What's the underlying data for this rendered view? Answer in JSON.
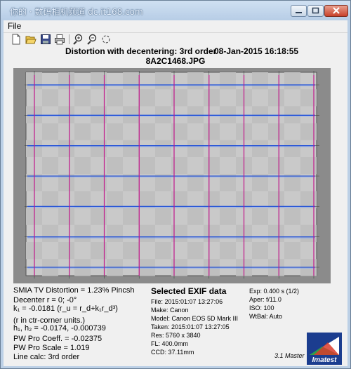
{
  "window": {
    "title": "你的 · 数码相机频道 dc.it168.com"
  },
  "menu": {
    "file": "File"
  },
  "toolbar": {
    "buttons": [
      "new-icon",
      "open-folder-icon",
      "save-icon",
      "print-icon",
      "zoom-in-icon",
      "zoom-out-icon",
      "refresh-icon"
    ]
  },
  "chart_header": {
    "title": "Distortion with decentering:  3rd order",
    "date": "08-Jan-2015 16:18:55",
    "filename": "8A2C1468.JPG"
  },
  "chart_data": {
    "type": "grid-overlay",
    "vertical_line_color": "#c2188b",
    "horizontal_line_color": "#1f4fd8",
    "vertical_lines": 9,
    "horizontal_lines": 7
  },
  "left_panel": {
    "smia": "SMIA TV Distortion = 1.23% Pincsh",
    "decenter": "Decenter r = 0;  -0°",
    "k1": "k₁ = -0.0181  (r_u = r_d+k₁r_d³)",
    "units": "(r in ctr-corner units.)",
    "h": "h₁, h₂ = -0.0174, -0.000739",
    "coeff": "PW Pro Coeff. = -0.02375",
    "scale": "PW Pro Scale = 1.019",
    "calc": "Line calc: 3rd order"
  },
  "exif": {
    "title": "Selected EXIF data",
    "file": "File:  2015:01:07 13:27:06",
    "make": "Make:  Canon",
    "model": "Model: Canon EOS 5D Mark III",
    "taken": "Taken: 2015:01:07 13:27:05",
    "res": "Res:   5760 x 3840",
    "fl": "FL:   400.0mm",
    "ccd": "CCD:   37.11mm",
    "exp": "Exp:  0.400 s  (1/2)",
    "aper": "Aper:  f/11.0",
    "iso": "ISO:   100",
    "wb": "WtBal:  Auto"
  },
  "footer": {
    "version": "3.1  Master",
    "logo_text": "Imatest"
  }
}
